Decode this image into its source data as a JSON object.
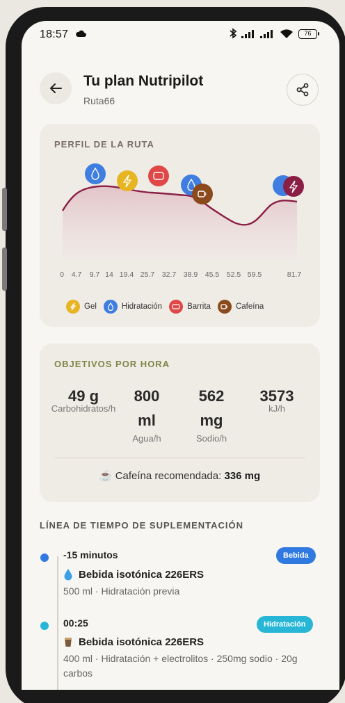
{
  "status_bar": {
    "time": "18:57",
    "battery": "76"
  },
  "header": {
    "title": "Tu plan Nutripilot",
    "subtitle": "Ruta66"
  },
  "profile": {
    "heading": "PERFIL DE LA RUTA",
    "heading_color": "#7a6e66",
    "line_color": "#8a1e45",
    "km_labels": [
      "0",
      "4.7",
      "9.7",
      "14",
      "19.4",
      "25.7",
      "32.7",
      "38.9",
      "45.5",
      "52.5",
      "59.5",
      "81.7"
    ],
    "legend": [
      {
        "label": "Gel",
        "color": "#e8b522",
        "icon": "bolt-icon"
      },
      {
        "label": "Hidratación",
        "color": "#3f7ee0",
        "icon": "drop-icon"
      },
      {
        "label": "Barrita",
        "color": "#e04848",
        "icon": "bar-icon"
      },
      {
        "label": "Cafeína",
        "color": "#8a4a1c",
        "icon": "coffee-icon"
      }
    ]
  },
  "objectives": {
    "heading": "OBJETIVOS POR HORA",
    "heading_color": "#7d8748",
    "metrics": [
      {
        "value": "49 g",
        "label": "Carbohidratos/h"
      },
      {
        "value_1": "800",
        "value_2": "ml",
        "label": "Agua/h"
      },
      {
        "value_1": "562",
        "value_2": "mg",
        "label": "Sodio/h"
      },
      {
        "value": "3573",
        "label": "kJ/h"
      }
    ],
    "caffeine_label": "Cafeína recomendada:",
    "caffeine_value": "336 mg",
    "caffeine_icon": "☕"
  },
  "timeline": {
    "heading": "LÍNEA DE TIEMPO DE SUPLEMENTACIÓN",
    "entries": [
      {
        "time": "-15 minutos",
        "badge": "Bebida",
        "badge_color": "#2f79e0",
        "dot_color": "#2f79e0",
        "icon": "droplet-icon",
        "name": "Bebida isotónica 226ERS",
        "desc": "500 ml · Hidratación previa"
      },
      {
        "time": "00:25",
        "badge": "Hidratación",
        "badge_color": "#27b6d6",
        "dot_color": "#27b6d6",
        "icon": "cup-icon",
        "name": "Bebida isotónica 226ERS",
        "desc": "400 ml · Hidratación + electrolitos · 250mg sodio · 20g carbos"
      }
    ]
  }
}
